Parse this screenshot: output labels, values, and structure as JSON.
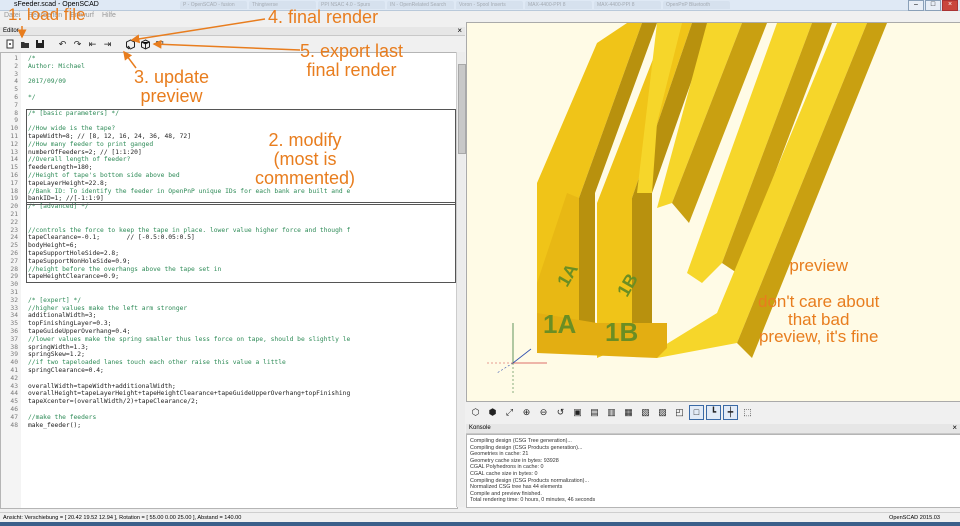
{
  "window": {
    "title": "sFeeder.scad - OpenSCAD",
    "browser_tabs": [
      "P - OpenSCAD - fusion",
      "Thingiverse",
      "PPI NSAC 4.0 - Spurs",
      "IN - OpenRelated Search",
      "Voron - Spool Inserts",
      "MAX-4400-PPI 8",
      "MAX-4400-PPI 8",
      "OpenPnP Bluetooth"
    ]
  },
  "menu": [
    "Datei",
    "Bearbeiten",
    "Entwurf",
    "Hilfe"
  ],
  "editor": {
    "title": "Editor",
    "close_label": "×",
    "toolbar": {
      "new_icon": "new-file-icon",
      "open_icon": "open-folder-icon",
      "save_icon": "save-icon",
      "undo_icon": "undo-icon",
      "redo_icon": "redo-icon",
      "unindent_icon": "unindent-icon",
      "indent_icon": "indent-icon",
      "preview_icon": "preview-icon",
      "render_icon": "render-icon",
      "export_stl_label": "STL"
    },
    "lines": [
      {
        "n": "1",
        "t": "/*",
        "c": true
      },
      {
        "n": "2",
        "t": "Author: Michael",
        "c": true
      },
      {
        "n": "3",
        "t": "",
        "c": true
      },
      {
        "n": "4",
        "t": "2017/09/09",
        "c": true
      },
      {
        "n": "5",
        "t": "",
        "c": true
      },
      {
        "n": "6",
        "t": "*/",
        "c": true
      },
      {
        "n": "7",
        "t": "",
        "c": false
      },
      {
        "n": "8",
        "t": "/* [basic parameters] */",
        "c": true
      },
      {
        "n": "9",
        "t": "",
        "c": false
      },
      {
        "n": "10",
        "t": "//How wide is the tape?",
        "c": true
      },
      {
        "n": "11",
        "t": "tapeWidth=8; // [8, 12, 16, 24, 36, 48, 72]",
        "c": false
      },
      {
        "n": "12",
        "t": "//How many feeder to print ganged",
        "c": true
      },
      {
        "n": "13",
        "t": "numberOfFeeders=2; // [1:1:20]",
        "c": false
      },
      {
        "n": "14",
        "t": "//Overall length of feeder?",
        "c": true
      },
      {
        "n": "15",
        "t": "feederLength=180;",
        "c": false
      },
      {
        "n": "16",
        "t": "//Height of tape's bottom side above bed",
        "c": true
      },
      {
        "n": "17",
        "t": "tapeLayerHeight=22.8;",
        "c": false
      },
      {
        "n": "18",
        "t": "//Bank ID: To identify the feeder in OpenPnP unique IDs for each bank are built and e",
        "c": true
      },
      {
        "n": "19",
        "t": "bankID=1; //[-1:1:9]",
        "c": false
      },
      {
        "n": "20",
        "t": "/* [advanced] */",
        "c": true
      },
      {
        "n": "21",
        "t": "",
        "c": false
      },
      {
        "n": "22",
        "t": "",
        "c": false
      },
      {
        "n": "23",
        "t": "//controls the force to keep the tape in place. lower value higher force and though f",
        "c": true
      },
      {
        "n": "24",
        "t": "tapeClearance=-0.1;       // [-0.5:0.05:0.5]",
        "c": false
      },
      {
        "n": "25",
        "t": "bodyHeight=6;",
        "c": false
      },
      {
        "n": "26",
        "t": "tapeSupportHoleSide=2.8;",
        "c": false
      },
      {
        "n": "27",
        "t": "tapeSupportNonHoleSide=0.9;",
        "c": false
      },
      {
        "n": "28",
        "t": "//height before the overhangs above the tape set in",
        "c": true
      },
      {
        "n": "29",
        "t": "tapeHeightClearance=0.9;",
        "c": false
      },
      {
        "n": "30",
        "t": "",
        "c": false
      },
      {
        "n": "31",
        "t": "",
        "c": false
      },
      {
        "n": "32",
        "t": "/* [expert] */",
        "c": true
      },
      {
        "n": "33",
        "t": "//higher values make the left arm stronger",
        "c": true
      },
      {
        "n": "34",
        "t": "additionalWidth=3;",
        "c": false
      },
      {
        "n": "35",
        "t": "topFinishingLayer=0.3;",
        "c": false
      },
      {
        "n": "36",
        "t": "tapeGuideUpperOverhang=0.4;",
        "c": false
      },
      {
        "n": "37",
        "t": "//lower values make the spring smaller thus less force on tape, should be slightly le",
        "c": true
      },
      {
        "n": "38",
        "t": "springWidth=1.3;",
        "c": false
      },
      {
        "n": "39",
        "t": "springSkew=1.2;",
        "c": false
      },
      {
        "n": "40",
        "t": "//if two tapeloaded lanes touch each other raise this value a little",
        "c": true
      },
      {
        "n": "41",
        "t": "springClearance=0.4;",
        "c": false
      },
      {
        "n": "42",
        "t": "",
        "c": false
      },
      {
        "n": "43",
        "t": "overallWidth=tapeWidth+additionalWidth;",
        "c": false
      },
      {
        "n": "44",
        "t": "overallHeight=tapeLayerHeight+tapeHeightClearance+tapeGuideUpperOverhang+topFinishing",
        "c": false
      },
      {
        "n": "45",
        "t": "tapeXcenter=(overallWidth/2)+tapeClearance/2;",
        "c": false
      },
      {
        "n": "46",
        "t": "",
        "c": false
      },
      {
        "n": "47",
        "t": "//make the feeders",
        "c": true
      },
      {
        "n": "48",
        "t": "make_feeder();",
        "c": false
      }
    ]
  },
  "viewport": {
    "labels": [
      "1A",
      "1A",
      "1B",
      "1B"
    ]
  },
  "view_toolbar": [
    "preview-icon",
    "render-icon",
    "view-all-icon",
    "zoom-in-icon",
    "zoom-out-icon",
    "reset-view-icon",
    "view-right-icon",
    "view-top-icon",
    "view-bottom-icon",
    "view-left-icon",
    "view-front-icon",
    "view-back-icon",
    "perspective-icon",
    "orthogonal-icon",
    "axes-icon",
    "scale-markers-icon",
    "edges-icon"
  ],
  "console": {
    "title": "Konsole",
    "close_label": "×",
    "lines": [
      "Compiling design (CSG Tree generation)...",
      "Compiling design (CSG Products generation)...",
      "Geometries in cache: 21",
      "Geometry cache size in bytes: 93928",
      "CGAL Polyhedrons in cache: 0",
      "CGAL cache size in bytes: 0",
      "Compiling design (CSG Products normalization)...",
      "Normalized CSG tree has 44 elements",
      "Compile and preview finished.",
      "Total rendering time: 0 hours, 0 minutes, 46 seconds"
    ]
  },
  "status": {
    "left": "Ansicht: Verschiebung = [ 20.42 19.52 12.94 ], Rotation = [ 55.00 0.00 25.00 ], Abstand = 140.00",
    "right": "OpenSCAD 2015.03"
  },
  "annotations": {
    "load": "1. load file",
    "final_render": "4. final render",
    "export": "5. export last\nfinal render",
    "update_preview": "3. update\npreview",
    "modify": "2. modify\n(most is\ncommented)",
    "preview_note": "preview\n\ndon't care about\nthat bad\npreview, it's fine"
  },
  "colors": {
    "annotation": "#e87d1e",
    "model_yellow": "#f5d31f",
    "model_dark": "#b8960f",
    "label_green": "#6b8e23"
  }
}
